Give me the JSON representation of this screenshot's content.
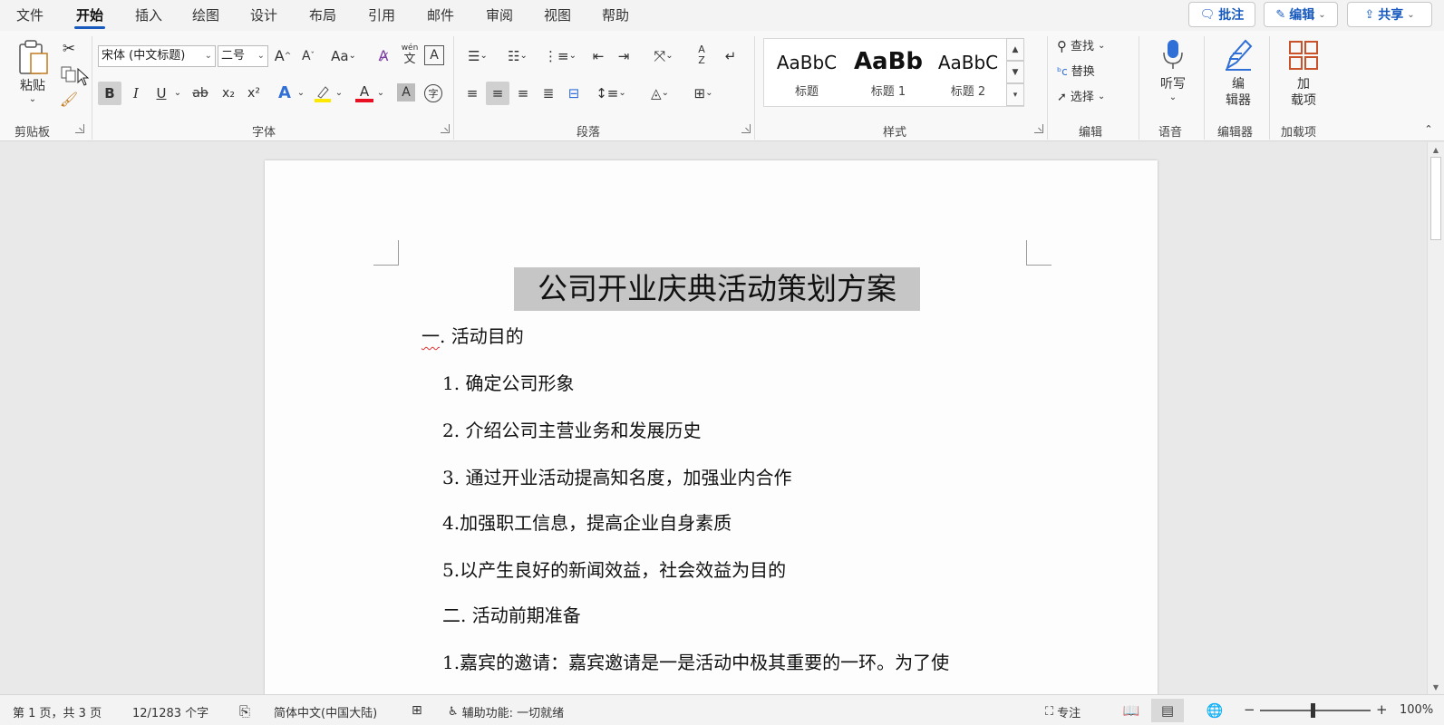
{
  "tabs": [
    "文件",
    "开始",
    "插入",
    "绘图",
    "设计",
    "布局",
    "引用",
    "邮件",
    "审阅",
    "视图",
    "帮助"
  ],
  "active_tab": "开始",
  "top_buttons": {
    "comment": "批注",
    "edit": "编辑",
    "share": "共享"
  },
  "clipboard": {
    "paste_label": "粘贴",
    "group_label": "剪贴板"
  },
  "font": {
    "font_name": "宋体 (中文标题)",
    "font_size": "二号",
    "grow": "A",
    "shrink": "A",
    "case": "Aa",
    "pinyin_top": "wén",
    "pinyin_bottom": "文",
    "bold": "B",
    "italic": "I",
    "underline": "U",
    "strike": "ab",
    "subscript": "x₂",
    "superscript": "x²",
    "text_effect": "A",
    "font_color": "A",
    "char_shading": "A",
    "enclose": "字",
    "group_label": "字体"
  },
  "paragraph": {
    "group_label": "段落",
    "sort_top": "A",
    "sort_bottom": "Z"
  },
  "styles": {
    "items": [
      {
        "preview": "AaBbC",
        "name": "标题"
      },
      {
        "preview": "AaBb",
        "name": "标题 1"
      },
      {
        "preview": "AaBbC",
        "name": "标题 2"
      }
    ],
    "group_label": "样式"
  },
  "editing": {
    "find": "查找",
    "replace": "替换",
    "select": "选择",
    "group_label": "编辑"
  },
  "voice": {
    "dictate": "听写",
    "group_label": "语音"
  },
  "editor": {
    "button_line1": "编",
    "button_line2": "辑器",
    "group_label": "编辑器"
  },
  "addins": {
    "button_line1": "加",
    "button_line2": "载项",
    "group_label": "加载项"
  },
  "document": {
    "title": "公司开业庆典活动策划方案",
    "heading1_prefix": "一",
    "heading1_rest": ". 活动目的",
    "lines": [
      "1. 确定公司形象",
      "2. 介绍公司主营业务和发展历史",
      "3. 通过开业活动提高知名度，加强业内合作",
      "4.加强职工信息，提高企业自身素质",
      "5.以产生良好的新闻效益，社会效益为目的",
      "二. 活动前期准备",
      "1.嘉宾的邀请：嘉宾邀请是一是活动中极其重要的一环。为了使"
    ]
  },
  "status": {
    "page": "第 1 页，共 3 页",
    "words": "12/1283 个字",
    "language": "简体中文(中国大陆)",
    "accessibility": "辅助功能: 一切就绪",
    "focus": "专注",
    "zoom_minus": "−",
    "zoom_plus": "+",
    "zoom": "100%"
  },
  "colors": {
    "accent": "#185abd",
    "highlight": "#ffe800",
    "font_red": "#e81123",
    "title_highlight": "#c6c6c6"
  }
}
